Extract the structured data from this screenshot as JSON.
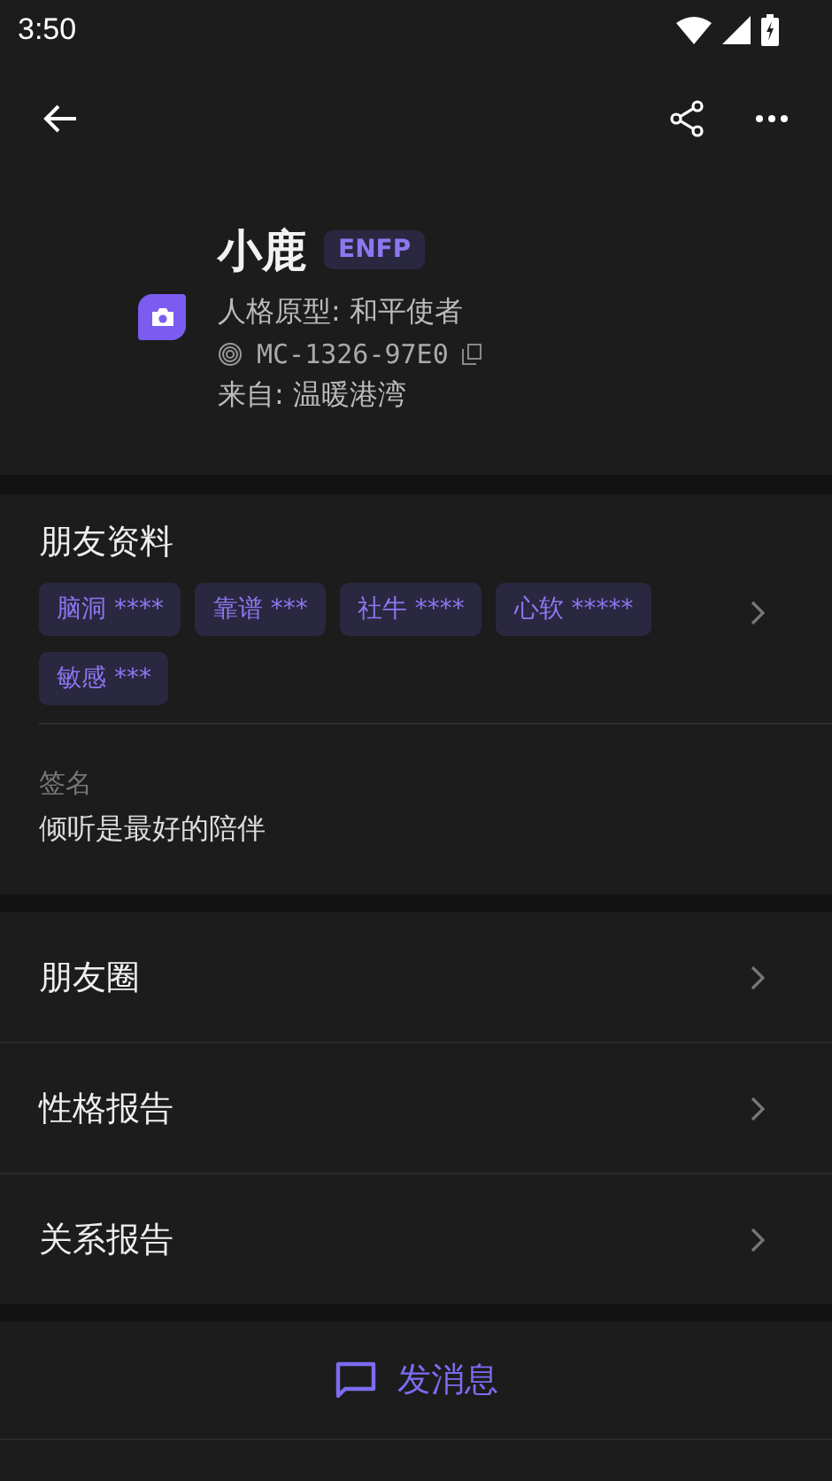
{
  "status_bar": {
    "time": "3:50"
  },
  "profile": {
    "name": "小鹿",
    "mbti": "ENFP",
    "archetype": "人格原型: 和平使者",
    "code": "MC-1326-97E0",
    "origin": "来自: 温暖港湾"
  },
  "friend_info": {
    "title": "朋友资料",
    "tags": [
      {
        "label": "脑洞 ****"
      },
      {
        "label": "靠谱 ***"
      },
      {
        "label": "社牛 ****"
      },
      {
        "label": "心软 *****"
      },
      {
        "label": "敏感 ***"
      }
    ],
    "signature_label": "签名",
    "signature": "倾听是最好的陪伴"
  },
  "menu": [
    {
      "label": "朋友圈"
    },
    {
      "label": "性格报告"
    },
    {
      "label": "关系报告"
    }
  ],
  "send_button": {
    "label": "发消息"
  }
}
